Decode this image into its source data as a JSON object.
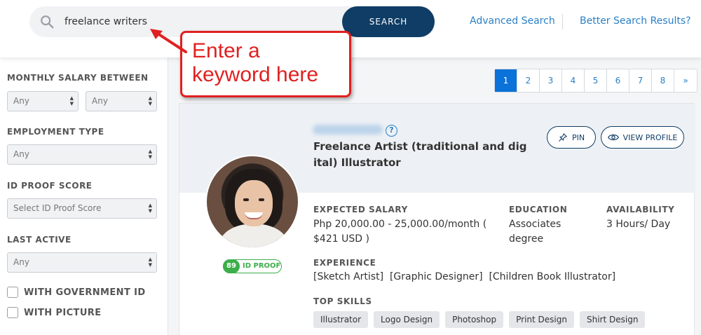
{
  "header": {
    "search_value": "freelance writers",
    "search_button": "SEARCH",
    "advanced_search": "Advanced Search",
    "better_results": "Better Search Results?"
  },
  "annotation": {
    "text": "Enter a keyword here",
    "color": "#e02020"
  },
  "sidebar": {
    "salary_label": "MONTHLY SALARY BETWEEN",
    "salary_min": "Any",
    "salary_max": "Any",
    "employment_label": "EMPLOYMENT TYPE",
    "employment_value": "Any",
    "idproof_label": "ID PROOF SCORE",
    "idproof_value": "Select ID Proof Score",
    "last_active_label": "LAST ACTIVE",
    "last_active_value": "Any",
    "gov_id_label": "WITH GOVERNMENT ID",
    "picture_label": "WITH PICTURE"
  },
  "pagination": {
    "pages": [
      "1",
      "2",
      "3",
      "4",
      "5",
      "6",
      "7",
      "8"
    ],
    "active": "1",
    "next": "»"
  },
  "result": {
    "title": "Freelance Artist (traditional and digital) Illustrator",
    "pin_label": "PIN",
    "view_profile_label": "VIEW PROFILE",
    "id_proof_score": "89",
    "id_proof_label": "ID PROOF",
    "expected_salary_label": "EXPECTED SALARY",
    "expected_salary_value": "Php 20,000.00 - 25,000.00/month ( $421 USD )",
    "education_label": "EDUCATION",
    "education_value": "Associates degree",
    "availability_label": "AVAILABILITY",
    "availability_value": "3 Hours/ Day",
    "experience_label": "EXPERIENCE",
    "experience_value": "[Sketch Artist]  [Graphic Designer]  [Children Book Illustrator]",
    "top_skills_label": "TOP SKILLS",
    "skills": [
      "Illustrator",
      "Logo Design",
      "Photoshop",
      "Print Design",
      "Shirt Design"
    ]
  },
  "colors": {
    "primary": "#0f3d66",
    "link": "#2a7fc7",
    "active_page": "#0a72d8",
    "badge_green": "#3cae4a"
  },
  "icons": {
    "search": "search-icon",
    "pin": "pin-icon",
    "eye": "eye-icon",
    "help": "question-icon"
  }
}
